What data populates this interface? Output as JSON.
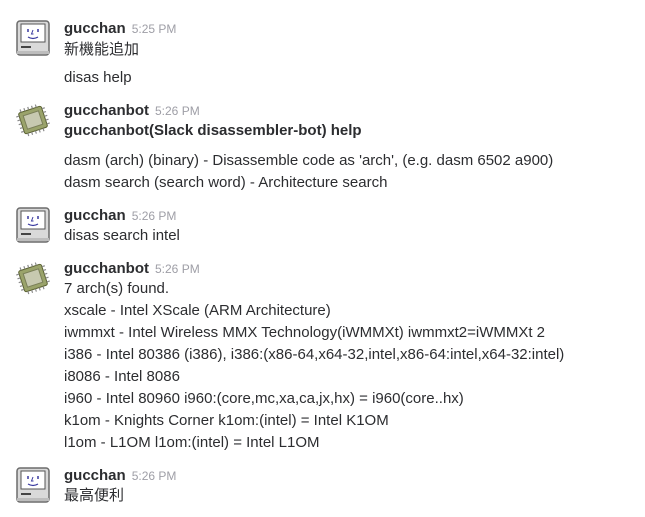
{
  "messages": [
    {
      "author": "gucchan",
      "time": "5:25 PM",
      "avatar": "mac-user-icon",
      "lines": [
        {
          "text": "新機能追加"
        },
        {
          "text": "disas help"
        }
      ]
    },
    {
      "author": "gucchanbot",
      "time": "5:26 PM",
      "avatar": "cpu-chip-icon",
      "lines": [
        {
          "text": "gucchanbot(Slack disassembler-bot) help",
          "bold": true
        },
        {
          "text": "dasm (arch) (binary) - Disassemble code as 'arch', (e.g. dasm 6502 a900)"
        },
        {
          "text": "dasm search (search word) - Architecture search"
        }
      ]
    },
    {
      "author": "gucchan",
      "time": "5:26 PM",
      "avatar": "mac-user-icon",
      "lines": [
        {
          "text": "disas search intel"
        }
      ]
    },
    {
      "author": "gucchanbot",
      "time": "5:26 PM",
      "avatar": "cpu-chip-icon",
      "lines": [
        {
          "text": "7 arch(s) found."
        },
        {
          "text": "xscale - Intel XScale (ARM Architecture)"
        },
        {
          "text": "iwmmxt - Intel Wireless MMX Technology(iWMMXt) iwmmxt2=iWMMXt 2"
        },
        {
          "text": "i386 - Intel 80386 (i386), i386:(x86-64,x64-32,intel,x86-64:intel,x64-32:intel)"
        },
        {
          "text": "i8086 - Intel 8086"
        },
        {
          "text": "i960 - Intel 80960 i960:(core,mc,xa,ca,jx,hx) = i960(core..hx)"
        },
        {
          "text": "k1om - Knights Corner k1om:(intel) = Intel K1OM"
        },
        {
          "text": "l1om - L1OM l1om:(intel) = Intel L1OM"
        }
      ]
    },
    {
      "author": "gucchan",
      "time": "5:26 PM",
      "avatar": "mac-user-icon",
      "lines": [
        {
          "text": "最高便利"
        }
      ]
    }
  ]
}
